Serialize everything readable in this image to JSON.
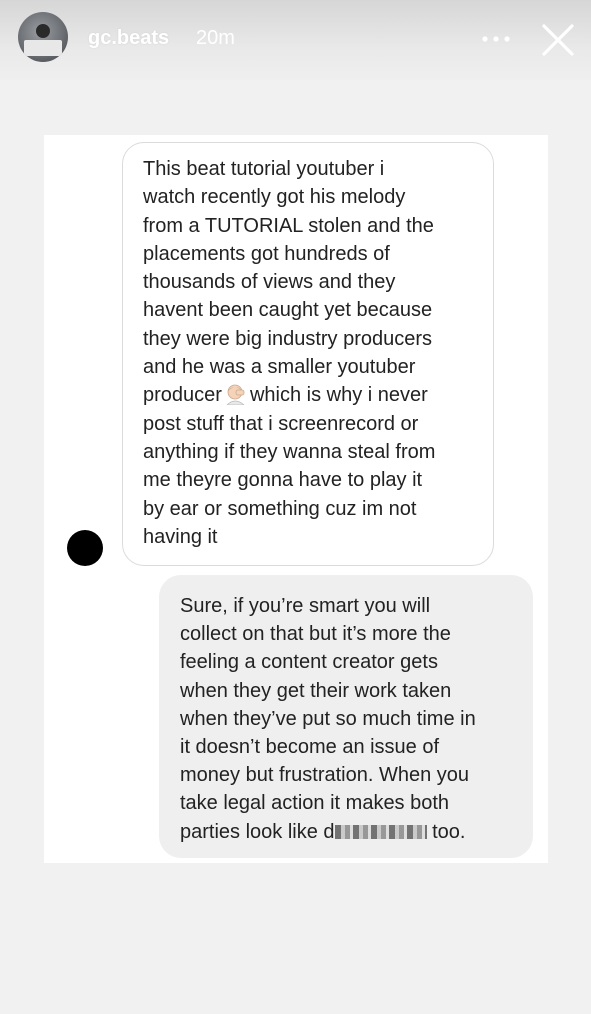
{
  "header": {
    "username": "gc.beats",
    "timestamp": "20m",
    "more_icon": "ellipsis-icon",
    "close_icon": "close-icon"
  },
  "messages": {
    "incoming": {
      "text_part1": "This beat tutorial youtuber i\nwatch recently got his melody\nfrom a TUTORIAL stolen and the\nplacements got hundreds of\nthousands of views and they\nhavent been caught yet because\nthey were big industry producers\nand he was a smaller youtuber\nproducer",
      "emoji": "man-facepalming-emoji",
      "text_part2": "which is why i never\npost stuff that i screenrecord or\nanything if they wanna steal from\nme theyre gonna have to play it\nby ear or something cuz im not\nhaving it"
    },
    "outgoing": {
      "text_part1": "Sure, if you’re smart you will\ncollect on that but it’s more the\nfeeling a content creator gets\nwhen they get their work taken\nwhen they’ve put so much time in\nit doesn’t become an issue of\nmoney but frustration. When you\ntake legal action it makes both\nparties look like d",
      "text_part2": "too."
    }
  },
  "colors": {
    "incoming_bubble_border": "#dbdbdb",
    "outgoing_bubble": "#efefef",
    "text": "#222222"
  }
}
